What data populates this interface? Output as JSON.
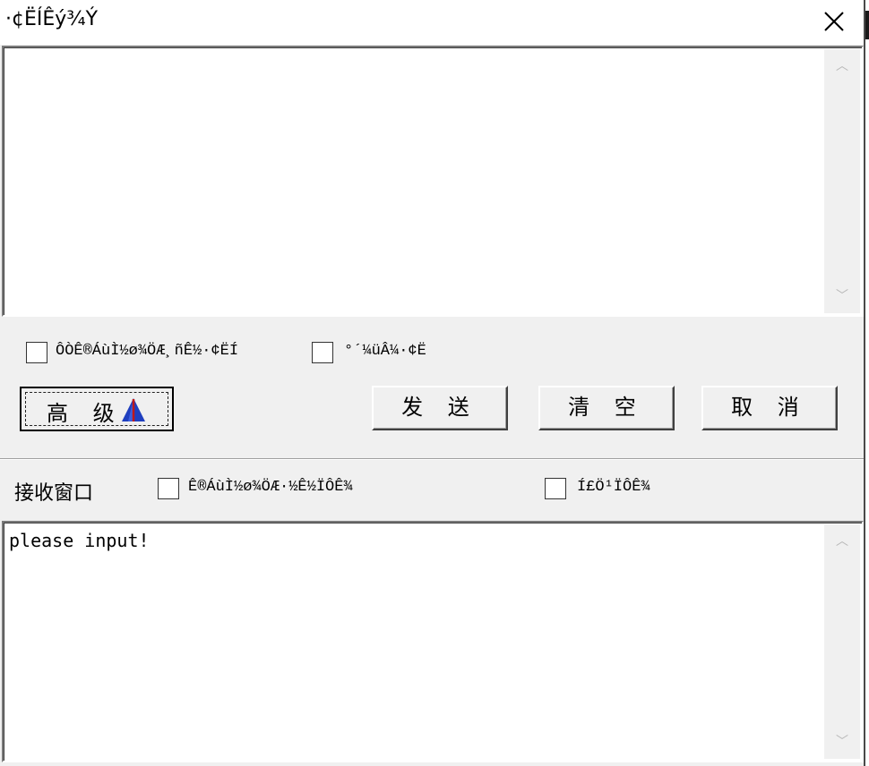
{
  "window": {
    "title": "·¢ËÍÊý¾Ý",
    "close_glyph": "✕"
  },
  "send_area": {
    "content": ""
  },
  "options": {
    "checkbox1_label": "ÔÒÊ®ÁùÌ½ø¾ÖÆ¸ñÊ½·¢ËÍ",
    "checkbox2_label": "°´¼üÂ¼·¢Ë"
  },
  "buttons": {
    "advanced": "高 级",
    "send": "发 送",
    "clear": "清 空",
    "cancel": "取 消"
  },
  "receive": {
    "title": "接收窗口",
    "checkbox1_label": "Ê®ÁùÌ½ø¾ÖÆ·½Ê½ÏÔÊ¾",
    "checkbox2_label": "Í£Ö¹ÏÔÊ¾",
    "content": "please input!"
  },
  "icons": {
    "advanced_icon": "tent-arrow-icon",
    "scroll_up": "chevron-up-icon",
    "scroll_down": "chevron-down-icon",
    "close": "close-icon"
  },
  "colors": {
    "window_bg": "#f0f0f0",
    "field_bg": "#ffffff",
    "icon_blue": "#1f3fbf",
    "icon_red": "#c01818"
  }
}
